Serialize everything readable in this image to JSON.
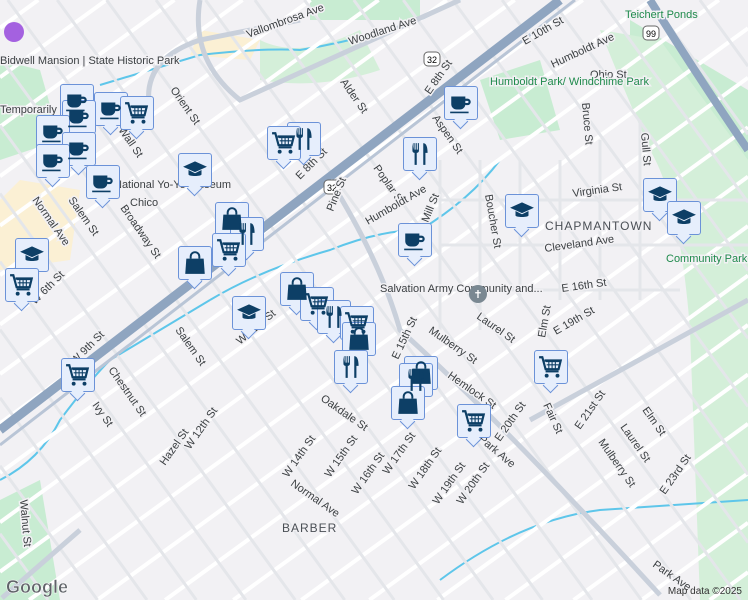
{
  "places": {
    "bidwell": "Bidwell Mansion | State Historic Park",
    "bidwell_status": "Temporarily closed",
    "yoyo": "National Yo-Yo Museum",
    "chico": "Chico",
    "salvation": "Salvation Army Community and...",
    "humboldt_park": "Humboldt Park/ Windchime Park",
    "teichert": "Teichert Ponds",
    "community_park": "Community Park",
    "chapmantown": "CHAPMANTOWN",
    "barber": "BARBER"
  },
  "streets": [
    "Vallombrosa Ave",
    "Woodland Ave",
    "E 10th St",
    "Humboldt Ave",
    "Ohio St",
    "Alder St",
    "E 8th St",
    "Aspen St",
    "Poplar St",
    "Pine St",
    "Humboldt Ave",
    "Mill St",
    "Boucher St",
    "Bruce St",
    "Gull St",
    "Virginia St",
    "Cleveland Ave",
    "E 16th St",
    "Laurel St",
    "Mulberry St",
    "Elm St",
    "E 19th St",
    "Hemlock St",
    "E 20th St",
    "Fair St",
    "E 21st St",
    "Elm St",
    "Laurel St",
    "Mulberry St",
    "E 23rd St",
    "Park Ave",
    "W 20th St",
    "W 19th St",
    "W 18th St",
    "W 17th St",
    "W 16th St",
    "W 15th St",
    "W 14th St",
    "Normal Ave",
    "Oakdale St",
    "Hazel St",
    "W 12th St",
    "Chestnut St",
    "Ivy St",
    "Walnut St",
    "W 9th St",
    "Salem St",
    "W 11th St",
    "Broadway St",
    "Salem St",
    "Normal Ave",
    "W 6th St",
    "Orient St",
    "Wall St",
    "E 15th St",
    "E 8th St",
    "Park Ave"
  ],
  "shields": [
    "32",
    "32",
    "99"
  ],
  "markers": {
    "coffee": "coffee-shop",
    "cart": "grocery-store",
    "cap": "school",
    "food": "restaurant",
    "bag": "shopping"
  },
  "footer": {
    "logo": "Google",
    "attribution": "Map data ©2025"
  },
  "colors": {
    "marker_bg": "#e6eefc",
    "marker_border": "#6b92d8",
    "icon": "#0d3f66",
    "park": "#c8ecd2",
    "water": "#5ec6ea"
  }
}
